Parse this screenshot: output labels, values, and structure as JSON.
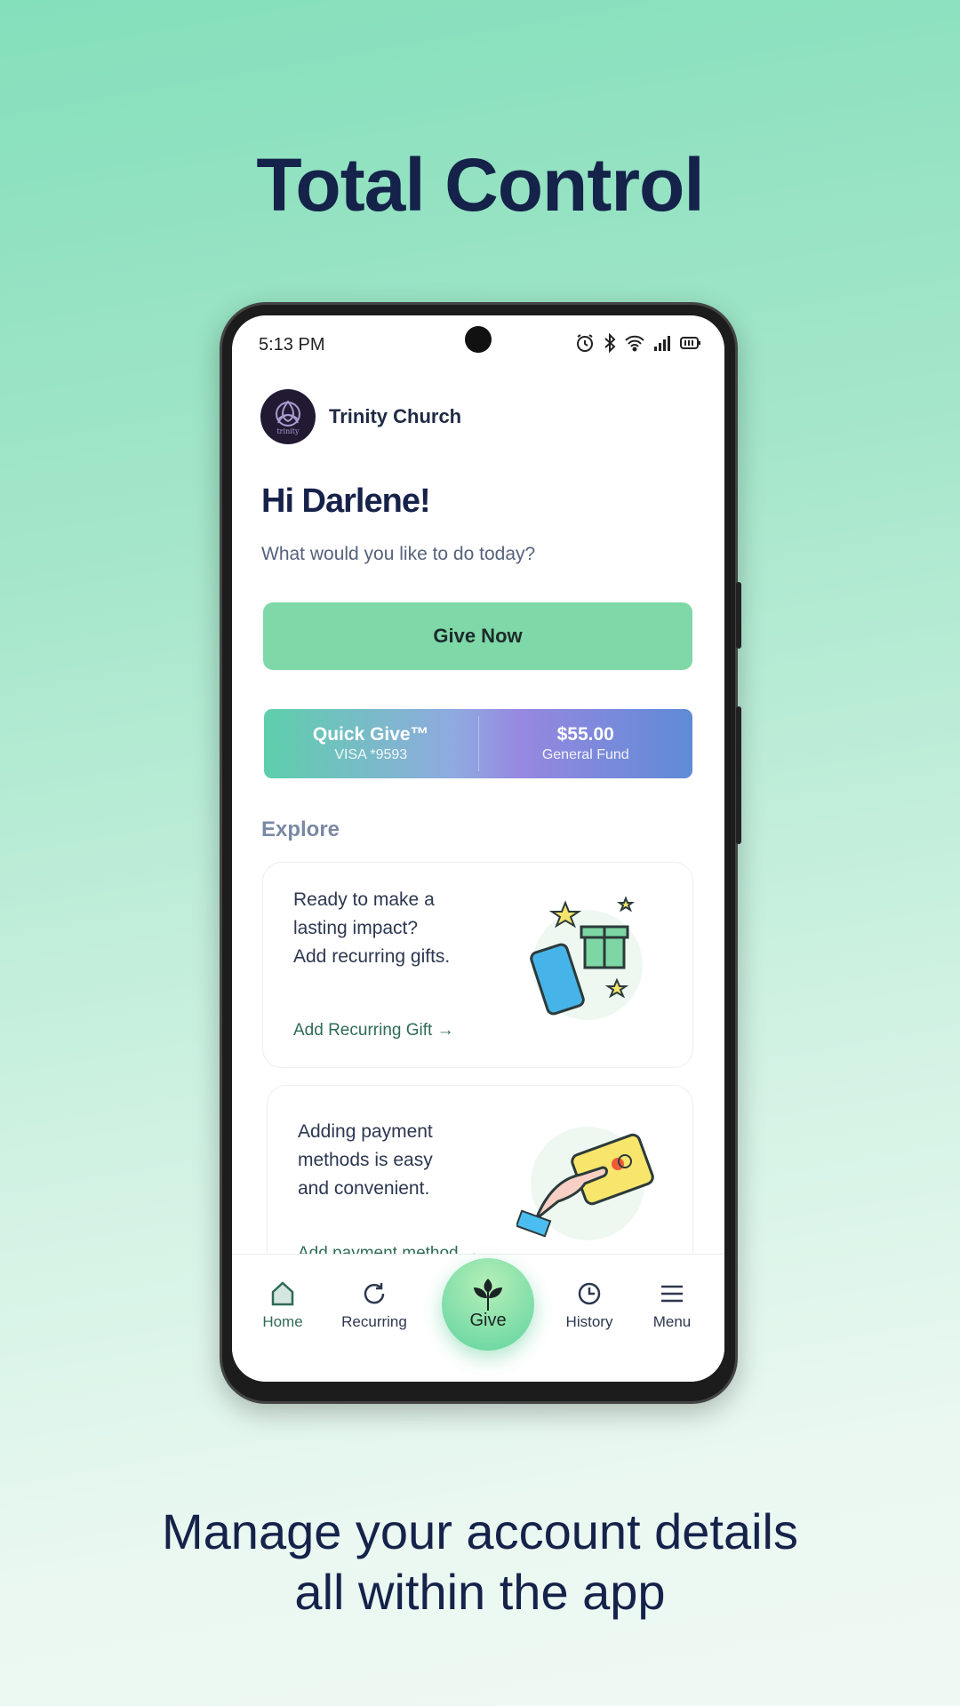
{
  "promo": {
    "title": "Total Control",
    "tagline_line1": "Manage your account details",
    "tagline_line2": "all within the app"
  },
  "status_bar": {
    "time": "5:13 PM",
    "icons": [
      "alarm-icon",
      "bluetooth-icon",
      "wifi-icon",
      "signal-icon",
      "battery-icon"
    ]
  },
  "header": {
    "church_name": "Trinity Church",
    "logo_text": "trinity"
  },
  "greeting": {
    "title": "Hi Darlene!",
    "subtitle": "What would you like to do today?"
  },
  "give_now_label": "Give Now",
  "quick_give": {
    "title": "Quick Give™",
    "card": "VISA *9593",
    "amount": "$55.00",
    "fund": "General Fund"
  },
  "explore": {
    "heading": "Explore",
    "cards": [
      {
        "lines": [
          "Ready to make a",
          "lasting impact?",
          "Add recurring gifts."
        ],
        "link": "Add Recurring Gift"
      },
      {
        "lines": [
          "Adding payment",
          "methods is easy",
          "and convenient."
        ],
        "link": "Add payment method"
      }
    ]
  },
  "nav": {
    "items": [
      {
        "label": "Home",
        "icon": "home-icon",
        "active": true
      },
      {
        "label": "Recurring",
        "icon": "refresh-icon"
      },
      {
        "label": "Give",
        "icon": "sprout-icon"
      },
      {
        "label": "History",
        "icon": "clock-icon"
      },
      {
        "label": "Menu",
        "icon": "menu-icon"
      }
    ]
  },
  "colors": {
    "accent": "#7fd8a8",
    "text": "#17224a",
    "link": "#2f6b55"
  }
}
